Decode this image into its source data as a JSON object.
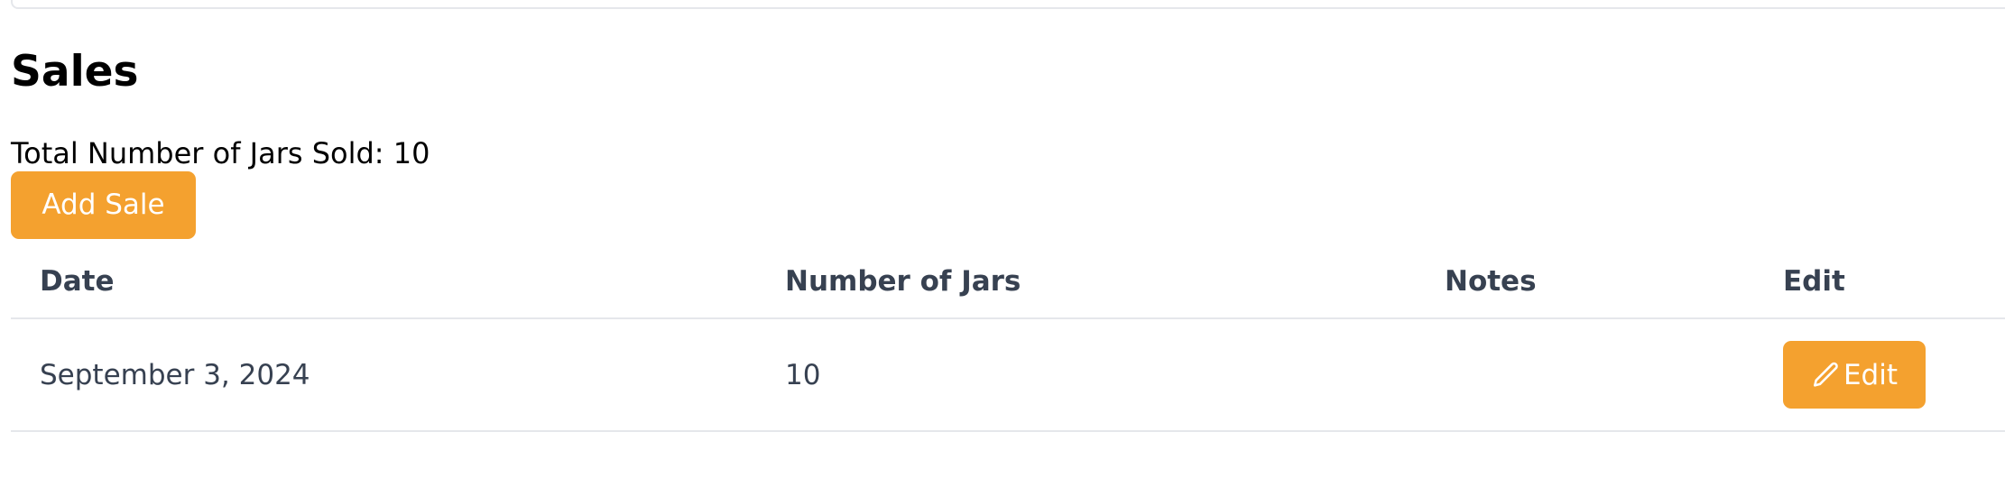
{
  "sales": {
    "title": "Sales",
    "total_label": "Total Number of Jars Sold: 10",
    "add_button_label": "Add Sale",
    "table": {
      "columns": [
        "Date",
        "Number of Jars",
        "Notes",
        "Edit"
      ],
      "rows": [
        {
          "date": "September 3, 2024",
          "jars": "10",
          "notes": "",
          "edit_label": "Edit",
          "edit_icon": "pencil-icon"
        }
      ]
    }
  },
  "colors": {
    "accent": "#f4a12f",
    "table_text": "#374151",
    "divider": "#e5e7eb"
  }
}
